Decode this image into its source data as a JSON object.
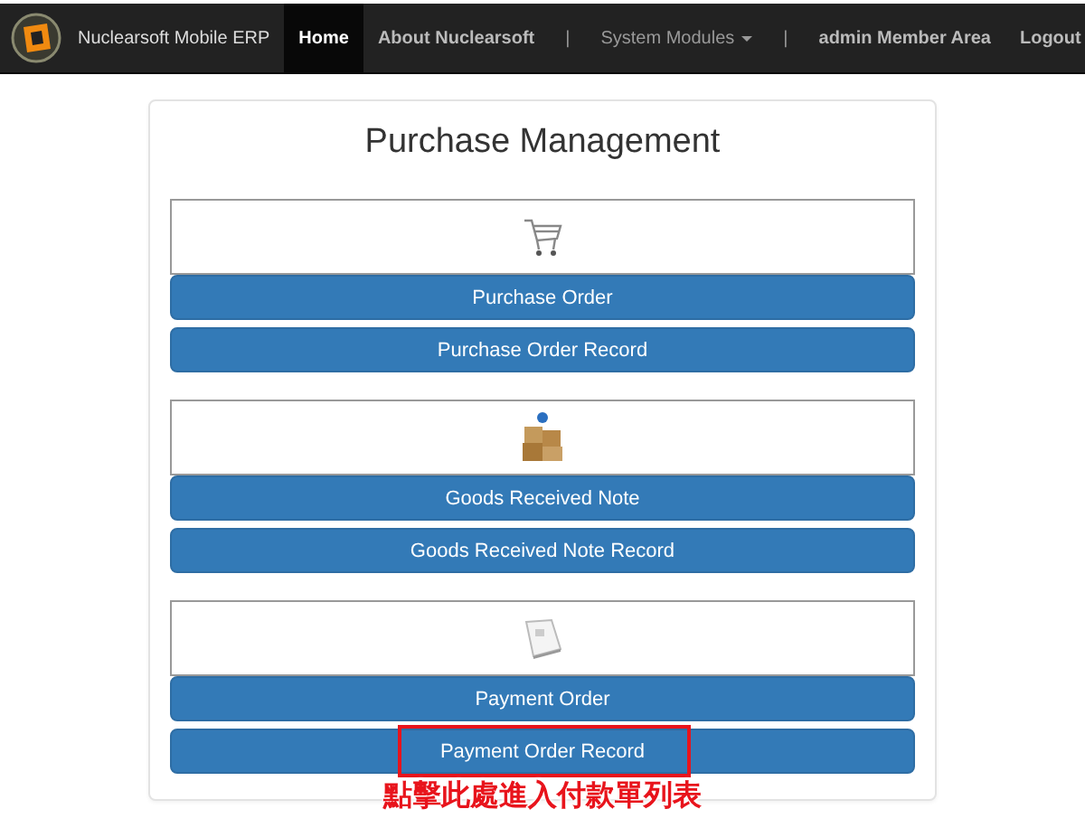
{
  "navbar": {
    "brand": "Nuclearsoft Mobile ERP",
    "items": [
      {
        "kind": "link",
        "label": "Home",
        "selected": true
      },
      {
        "kind": "link",
        "label": "About Nuclearsoft",
        "selected": false
      },
      {
        "kind": "separator",
        "label": "|"
      },
      {
        "kind": "dropdown",
        "label": "System Modules",
        "selected": false
      },
      {
        "kind": "separator",
        "label": "|"
      },
      {
        "kind": "link",
        "label": "admin Member Area",
        "selected": false
      },
      {
        "kind": "link",
        "label": "Logout",
        "selected": false
      }
    ]
  },
  "panel": {
    "title": "Purchase Management",
    "sections": [
      {
        "kind": "cart",
        "buttons": [
          {
            "label": "Purchase Order",
            "highlighted": false
          },
          {
            "label": "Purchase Order Record",
            "highlighted": false
          }
        ]
      },
      {
        "kind": "boxes",
        "buttons": [
          {
            "label": "Goods Received Note",
            "highlighted": false
          },
          {
            "label": "Goods Received Note Record",
            "highlighted": false
          }
        ]
      },
      {
        "kind": "document",
        "buttons": [
          {
            "label": "Payment Order",
            "highlighted": false
          },
          {
            "label": "Payment Order Record",
            "highlighted": true
          }
        ]
      }
    ]
  },
  "annotation": {
    "text": "點擊此處進入付款單列表"
  }
}
